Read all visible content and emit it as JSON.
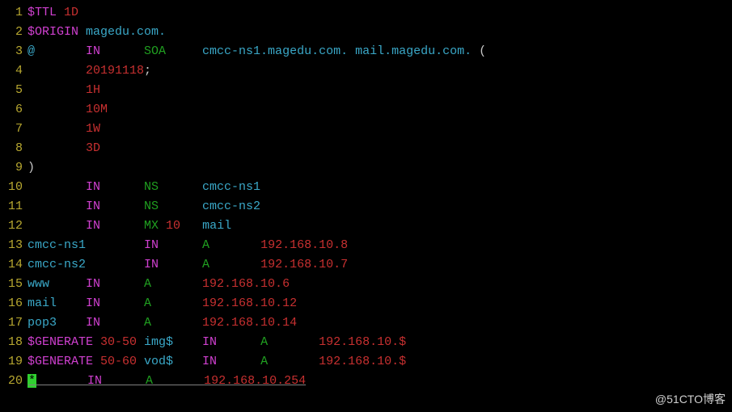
{
  "watermark": "@51CTO博客",
  "lines": [
    {
      "n": "1",
      "seg": [
        {
          "c": "magenta",
          "t": "$TTL "
        },
        {
          "c": "red",
          "t": "1D"
        }
      ]
    },
    {
      "n": "2",
      "seg": [
        {
          "c": "magenta",
          "t": "$ORIGIN "
        },
        {
          "c": "cyan",
          "t": "magedu.com."
        }
      ]
    },
    {
      "n": "3",
      "seg": [
        {
          "c": "cyan",
          "t": "@       "
        },
        {
          "c": "magenta",
          "t": "IN      "
        },
        {
          "c": "green",
          "t": "SOA     "
        },
        {
          "c": "cyan",
          "t": "cmcc-ns1.magedu.com. mail.magedu.com."
        },
        {
          "c": "white",
          "t": " ("
        }
      ]
    },
    {
      "n": "4",
      "seg": [
        {
          "c": "white",
          "t": "        "
        },
        {
          "c": "red",
          "t": "20191118"
        },
        {
          "c": "white",
          "t": ";"
        }
      ]
    },
    {
      "n": "5",
      "seg": [
        {
          "c": "white",
          "t": "        "
        },
        {
          "c": "red",
          "t": "1H"
        }
      ]
    },
    {
      "n": "6",
      "seg": [
        {
          "c": "white",
          "t": "        "
        },
        {
          "c": "red",
          "t": "10M"
        }
      ]
    },
    {
      "n": "7",
      "seg": [
        {
          "c": "white",
          "t": "        "
        },
        {
          "c": "red",
          "t": "1W"
        }
      ]
    },
    {
      "n": "8",
      "seg": [
        {
          "c": "white",
          "t": "        "
        },
        {
          "c": "red",
          "t": "3D"
        }
      ]
    },
    {
      "n": "9",
      "seg": [
        {
          "c": "white",
          "t": ")"
        }
      ]
    },
    {
      "n": "10",
      "seg": [
        {
          "c": "white",
          "t": "        "
        },
        {
          "c": "magenta",
          "t": "IN      "
        },
        {
          "c": "green",
          "t": "NS      "
        },
        {
          "c": "cyan",
          "t": "cmcc-ns1"
        }
      ]
    },
    {
      "n": "11",
      "seg": [
        {
          "c": "white",
          "t": "        "
        },
        {
          "c": "magenta",
          "t": "IN      "
        },
        {
          "c": "green",
          "t": "NS      "
        },
        {
          "c": "cyan",
          "t": "cmcc-ns2"
        }
      ]
    },
    {
      "n": "12",
      "seg": [
        {
          "c": "white",
          "t": "        "
        },
        {
          "c": "magenta",
          "t": "IN      "
        },
        {
          "c": "green",
          "t": "MX "
        },
        {
          "c": "red",
          "t": "10   "
        },
        {
          "c": "cyan",
          "t": "mail"
        }
      ]
    },
    {
      "n": "13",
      "seg": [
        {
          "c": "cyan",
          "t": "cmcc-ns1        "
        },
        {
          "c": "magenta",
          "t": "IN      "
        },
        {
          "c": "green",
          "t": "A       "
        },
        {
          "c": "red",
          "t": "192.168.10.8"
        }
      ]
    },
    {
      "n": "14",
      "seg": [
        {
          "c": "cyan",
          "t": "cmcc-ns2        "
        },
        {
          "c": "magenta",
          "t": "IN      "
        },
        {
          "c": "green",
          "t": "A       "
        },
        {
          "c": "red",
          "t": "192.168.10.7"
        }
      ]
    },
    {
      "n": "15",
      "seg": [
        {
          "c": "cyan",
          "t": "www     "
        },
        {
          "c": "magenta",
          "t": "IN      "
        },
        {
          "c": "green",
          "t": "A       "
        },
        {
          "c": "red",
          "t": "192.168.10.6"
        }
      ]
    },
    {
      "n": "16",
      "seg": [
        {
          "c": "cyan",
          "t": "mail    "
        },
        {
          "c": "magenta",
          "t": "IN      "
        },
        {
          "c": "green",
          "t": "A       "
        },
        {
          "c": "red",
          "t": "192.168.10.12"
        }
      ]
    },
    {
      "n": "17",
      "seg": [
        {
          "c": "cyan",
          "t": "pop3    "
        },
        {
          "c": "magenta",
          "t": "IN      "
        },
        {
          "c": "green",
          "t": "A       "
        },
        {
          "c": "red",
          "t": "192.168.10.14"
        }
      ]
    },
    {
      "n": "18",
      "seg": [
        {
          "c": "magenta",
          "t": "$GENERATE "
        },
        {
          "c": "red",
          "t": "30-50 "
        },
        {
          "c": "cyan",
          "t": "img$    "
        },
        {
          "c": "magenta",
          "t": "IN      "
        },
        {
          "c": "green",
          "t": "A       "
        },
        {
          "c": "red",
          "t": "192.168.10.$"
        }
      ]
    },
    {
      "n": "19",
      "seg": [
        {
          "c": "magenta",
          "t": "$GENERATE "
        },
        {
          "c": "red",
          "t": "50-60 "
        },
        {
          "c": "cyan",
          "t": "vod$    "
        },
        {
          "c": "magenta",
          "t": "IN      "
        },
        {
          "c": "green",
          "t": "A       "
        },
        {
          "c": "red",
          "t": "192.168.10.$"
        }
      ]
    },
    {
      "n": "20",
      "cursor": true,
      "seg": [
        {
          "c": "cursor-blk",
          "t": "*"
        },
        {
          "c": "cyan",
          "t": "       "
        },
        {
          "c": "magenta",
          "t": "IN      "
        },
        {
          "c": "green",
          "t": "A       "
        },
        {
          "c": "red",
          "t": "192.168.10.254"
        }
      ]
    }
  ]
}
